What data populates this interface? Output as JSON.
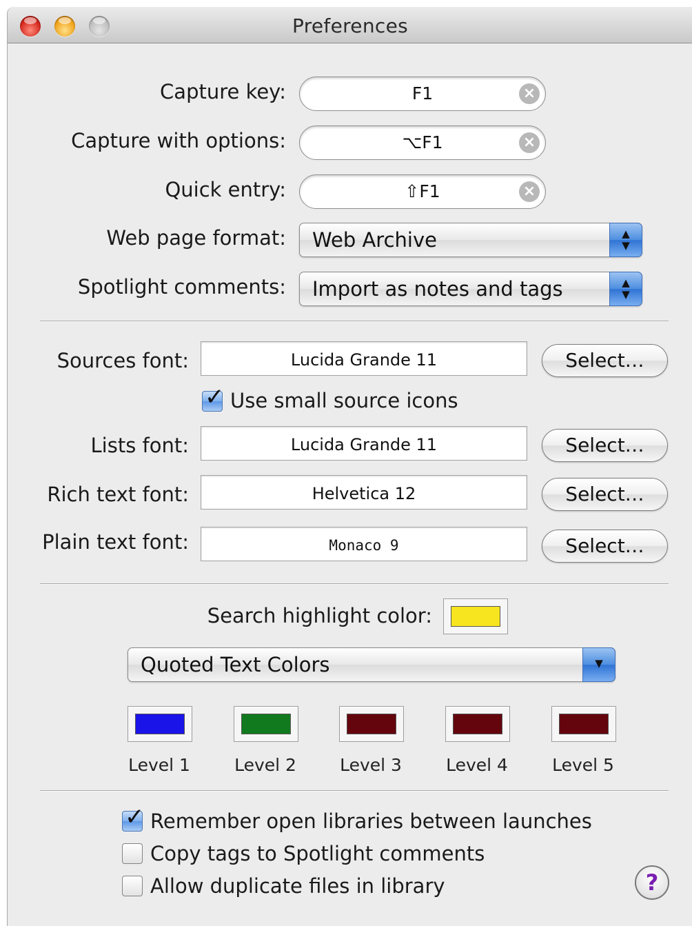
{
  "window": {
    "title": "Preferences"
  },
  "general": {
    "capture_key": {
      "label": "Capture key:",
      "value": "F1"
    },
    "capture_options": {
      "label": "Capture with options:",
      "value": "⌥F1"
    },
    "quick_entry": {
      "label": "Quick entry:",
      "value": "⇧F1"
    },
    "web_page_format": {
      "label": "Web page format:",
      "value": "Web Archive"
    },
    "spotlight_comments": {
      "label": "Spotlight comments:",
      "value": "Import as notes and tags"
    }
  },
  "fonts": {
    "sources": {
      "label": "Sources font:",
      "value": "Lucida Grande 11",
      "button": "Select…"
    },
    "small_icons": {
      "label": "Use small source icons",
      "checked": true
    },
    "lists": {
      "label": "Lists font:",
      "value": "Lucida Grande 11",
      "button": "Select…"
    },
    "rich_text": {
      "label": "Rich text font:",
      "value": "Helvetica 12",
      "button": "Select…"
    },
    "plain_text": {
      "label": "Plain text font:",
      "value": "Monaco 9",
      "button": "Select…"
    }
  },
  "colors": {
    "search_highlight": {
      "label": "Search highlight color:",
      "color": "#f7e51f"
    },
    "quoted_menu": "Quoted Text Colors",
    "levels": [
      {
        "label": "Level 1",
        "color": "#1a14e8"
      },
      {
        "label": "Level 2",
        "color": "#117a1e"
      },
      {
        "label": "Level 3",
        "color": "#64050d"
      },
      {
        "label": "Level 4",
        "color": "#64050d"
      },
      {
        "label": "Level 5",
        "color": "#64050d"
      }
    ]
  },
  "options": [
    {
      "label": "Remember open libraries between launches",
      "checked": true
    },
    {
      "label": "Copy tags to Spotlight comments",
      "checked": false
    },
    {
      "label": "Allow duplicate files in library",
      "checked": false
    }
  ],
  "icons": {
    "clear": "clear-icon",
    "popup_arrows": "popup-arrows-icon",
    "help": "help-icon",
    "checkmark": "checkmark-icon"
  }
}
